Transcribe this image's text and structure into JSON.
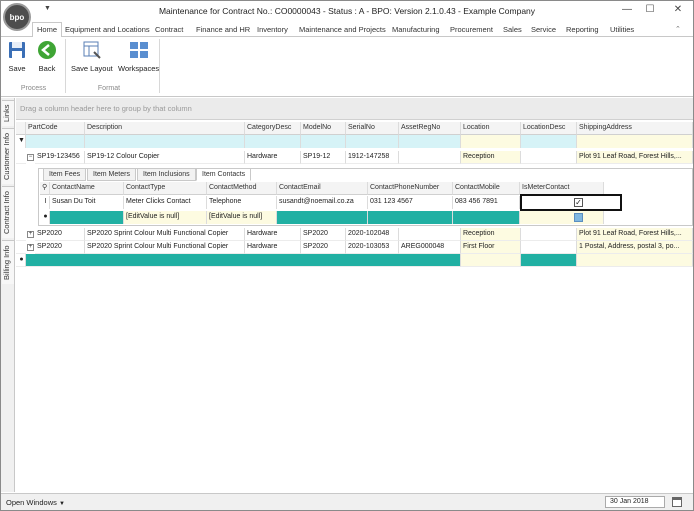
{
  "window": {
    "title": "Maintenance for Contract No.: CO0000043 - Status : A - BPO: Version 2.1.0.43 - Example Company",
    "logo_text": "bpo"
  },
  "ribbon_tabs": [
    "Home",
    "Equipment and Locations",
    "Contract",
    "Finance and HR",
    "Inventory",
    "Maintenance and Projects",
    "Manufacturing",
    "Procurement",
    "Sales",
    "Service",
    "Reporting",
    "Utilities"
  ],
  "ribbon": {
    "save_label": "Save",
    "back_label": "Back",
    "save_layout_label": "Save Layout",
    "workspaces_label": "Workspaces",
    "group_process": "Process",
    "group_format": "Format"
  },
  "side_tabs": [
    "Links",
    "Customer Info",
    "Contract Info",
    "Billing Info"
  ],
  "grid": {
    "group_panel_text": "Drag a column header here to group by that column",
    "columns": [
      "PartCode",
      "Description",
      "CategoryDesc",
      "ModelNo",
      "SerialNo",
      "AssetRegNo",
      "Location",
      "LocationDesc",
      "ShippingAddress"
    ],
    "rows": [
      {
        "part_code": "SP19-123456",
        "description": "SP19-12 Colour Copier",
        "category": "Hardware",
        "model": "SP19-12",
        "serial": "1912-147258",
        "asset": "",
        "location": "Reception",
        "location_desc": "",
        "shipping": "Plot 91 Leaf Road, Forest Hills,..."
      },
      {
        "part_code": "SP2020",
        "description": "SP2020 Sprint Colour Multi Functional Copier",
        "category": "Hardware",
        "model": "SP2020",
        "serial": "2020-102048",
        "asset": "",
        "location": "Reception",
        "location_desc": "",
        "shipping": "Plot 91 Leaf Road, Forest Hills,..."
      },
      {
        "part_code": "SP2020",
        "description": "SP2020 Sprint Colour Multi Functional Copier",
        "category": "Hardware",
        "model": "SP2020",
        "serial": "2020-103053",
        "asset": "AREG000048",
        "location": "First Floor",
        "location_desc": "",
        "shipping": "1 Postal, Address, postal 3, po..."
      }
    ]
  },
  "detail": {
    "tabs": [
      "Item Fees",
      "Item Meters",
      "Item Inclusions",
      "Item Contacts"
    ],
    "active_tab": "Item Contacts",
    "columns": [
      "ContactName",
      "ContactType",
      "ContactMethod",
      "ContactEmail",
      "ContactPhoneNumber",
      "ContactMobile",
      "IsMeterContact"
    ],
    "row": {
      "name": "Susan Du Toit",
      "type": "Meter Clicks Contact",
      "method": "Telephone",
      "email": "susandt@noemail.co.za",
      "phone": "031 123 4567",
      "mobile": "083 456 7891",
      "is_meter_contact": true
    },
    "new_row_null_text": "[EditValue is null]"
  },
  "status": {
    "open_windows": "Open Windows",
    "date": "30 Jan 2018"
  },
  "colors": {
    "accent_teal": "#21b0a3",
    "filter_row": "#d6f3f7",
    "yellow_cell": "#fdfbe1"
  }
}
